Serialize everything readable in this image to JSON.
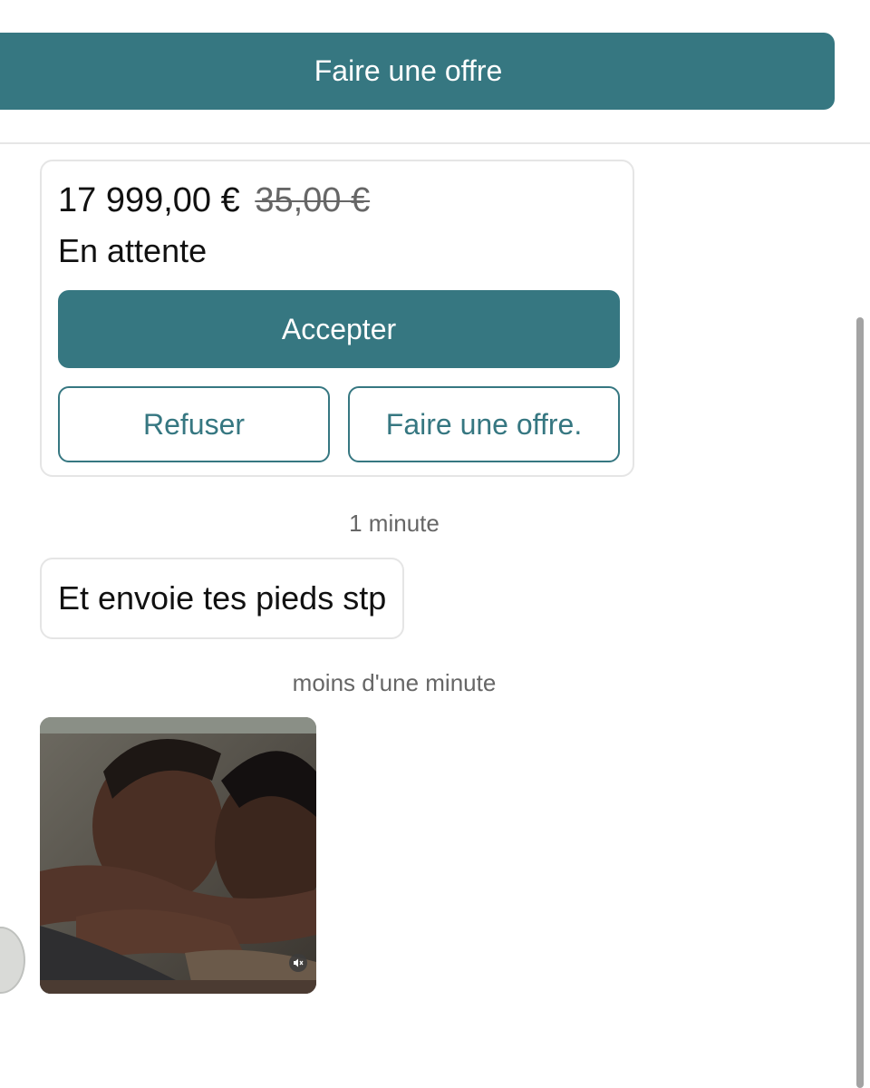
{
  "header": {
    "make_offer_label": "Faire une offre"
  },
  "offer": {
    "price": "17 999,00 €",
    "original_price": "35,00 €",
    "status": "En attente",
    "accept_label": "Accepter",
    "refuse_label": "Refuser",
    "counter_offer_label": "Faire une offre."
  },
  "messages": [
    {
      "timestamp": "1 minute",
      "text": "Et envoie tes pieds stp"
    },
    {
      "timestamp": "moins d'une minute",
      "attachment": "photo"
    }
  ],
  "icons": {
    "photo_sound": "sound-off-icon"
  },
  "colors": {
    "accent": "#367781",
    "border": "#e5e5e5",
    "muted_text": "#666666"
  }
}
